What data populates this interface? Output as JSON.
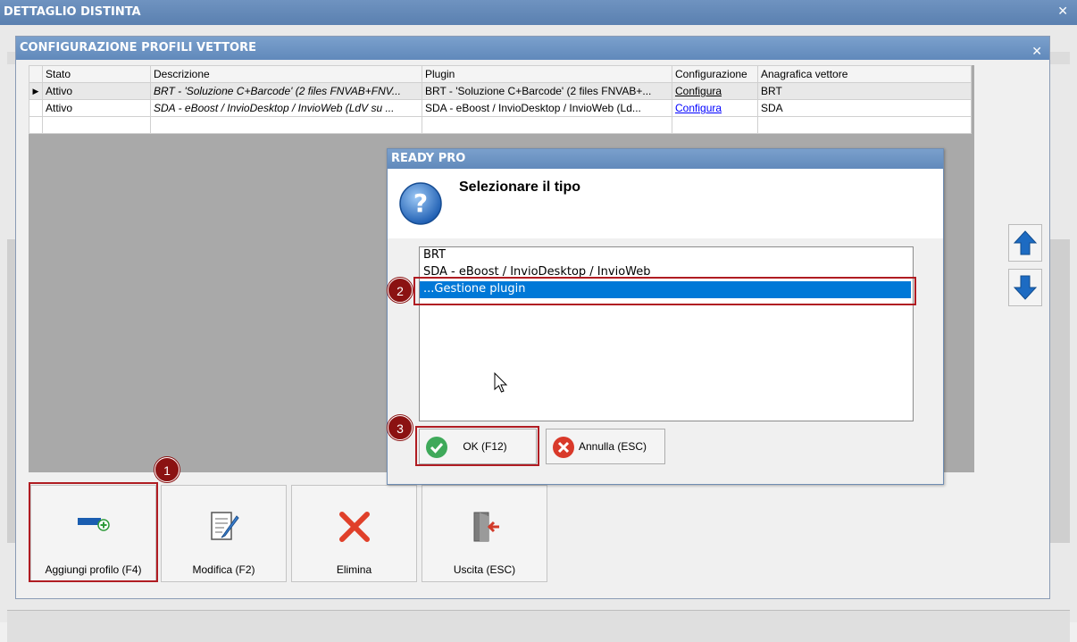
{
  "outer_window": {
    "title": "DETTAGLIO DISTINTA"
  },
  "config_window": {
    "title": "CONFIGURAZIONE PROFILI VETTORE"
  },
  "grid": {
    "columns": [
      "Stato",
      "Descrizione",
      "Plugin",
      "Configurazione",
      "Anagrafica vettore"
    ],
    "rows": [
      {
        "stato": "Attivo",
        "descrizione": "BRT - 'Soluzione C+Barcode' (2 files FNVAB+FNV...",
        "plugin": "BRT - 'Soluzione C+Barcode' (2 files FNVAB+...",
        "configurazione": "Configura",
        "anagrafica": "BRT"
      },
      {
        "stato": "Attivo",
        "descrizione": "SDA - eBoost / InvioDesktop / InvioWeb (LdV su ...",
        "plugin": "SDA - eBoost / InvioDesktop / InvioWeb (Ld...",
        "configurazione": "Configura",
        "anagrafica": "SDA"
      }
    ]
  },
  "buttons": {
    "add": "Aggiungi profilo (F4)",
    "edit": "Modifica (F2)",
    "delete": "Elimina",
    "exit": "Uscita (ESC)"
  },
  "dialog": {
    "title": "READY PRO",
    "heading": "Selezionare il tipo",
    "options": [
      "BRT",
      "SDA - eBoost / InvioDesktop / InvioWeb",
      "...Gestione plugin"
    ],
    "selected_option": "...Gestione plugin",
    "ok": "OK (F12)",
    "cancel": "Annulla (ESC)"
  },
  "callouts": [
    "1",
    "2",
    "3"
  ],
  "colors": {
    "title_bar": "#6189bb",
    "selection": "#0078d7",
    "callout": "#8b1212",
    "link": "#0000ff"
  },
  "icons": [
    "close-icon",
    "row-pointer-icon",
    "arrow-up-icon",
    "arrow-down-icon",
    "add-profile-icon",
    "edit-icon",
    "delete-x-icon",
    "exit-door-icon",
    "question-icon",
    "check-icon",
    "cancel-x-icon",
    "mouse-cursor-icon"
  ]
}
